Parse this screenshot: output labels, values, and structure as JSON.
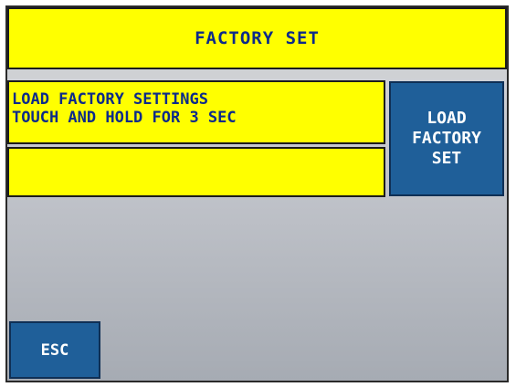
{
  "header": {
    "title": "FACTORY SET"
  },
  "info": {
    "line1": "LOAD FACTORY SETTINGS",
    "line2": "TOUCH AND HOLD FOR 3 SEC",
    "blank": ""
  },
  "buttons": {
    "load_factory_set": {
      "line1": "LOAD",
      "line2": "FACTORY",
      "line3": "SET"
    },
    "esc": "ESC"
  },
  "colors": {
    "panel_yellow": "#ffff00",
    "text_blue": "#0b2a8a",
    "button_blue": "#1f5f99",
    "background_gray": "#a6abb3"
  }
}
